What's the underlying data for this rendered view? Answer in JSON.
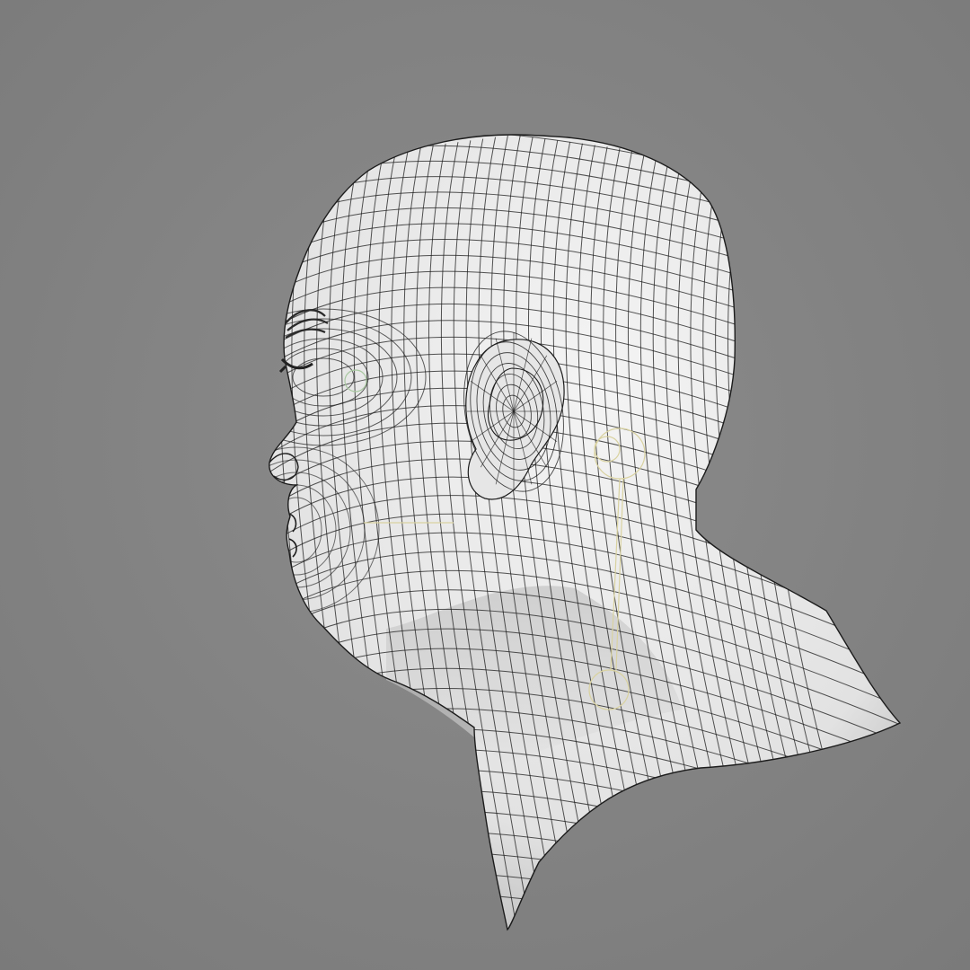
{
  "viewport": {
    "background_color": "#858585",
    "background_gradient_light": "#8c8c8c",
    "background_gradient_dark": "#7a7a7a"
  },
  "model": {
    "subject": "head-and-neck-bust",
    "view": "left-side-profile",
    "shading_color": "#e2e2e2",
    "shadow_color": "#b8b8b8",
    "wire_color": "#1c1c1c",
    "topology": "quad-mesh"
  },
  "rig": {
    "helper_color": "#d9d2a0",
    "helper_accent_color": "#a8c8a0"
  }
}
